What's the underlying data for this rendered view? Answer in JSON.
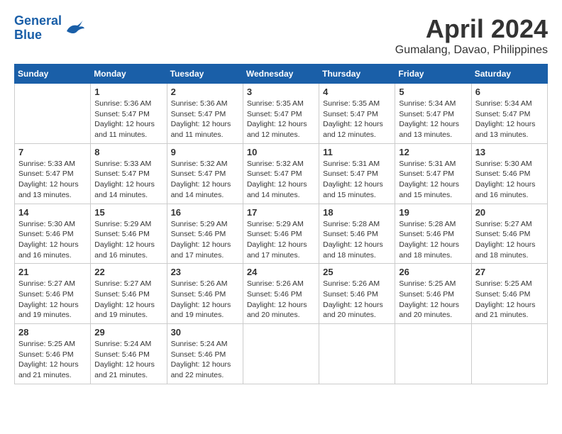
{
  "header": {
    "logo_line1": "General",
    "logo_line2": "Blue",
    "month_title": "April 2024",
    "subtitle": "Gumalang, Davao, Philippines"
  },
  "weekdays": [
    "Sunday",
    "Monday",
    "Tuesday",
    "Wednesday",
    "Thursday",
    "Friday",
    "Saturday"
  ],
  "weeks": [
    [
      {
        "day": "",
        "info": ""
      },
      {
        "day": "1",
        "info": "Sunrise: 5:36 AM\nSunset: 5:47 PM\nDaylight: 12 hours\nand 11 minutes."
      },
      {
        "day": "2",
        "info": "Sunrise: 5:36 AM\nSunset: 5:47 PM\nDaylight: 12 hours\nand 11 minutes."
      },
      {
        "day": "3",
        "info": "Sunrise: 5:35 AM\nSunset: 5:47 PM\nDaylight: 12 hours\nand 12 minutes."
      },
      {
        "day": "4",
        "info": "Sunrise: 5:35 AM\nSunset: 5:47 PM\nDaylight: 12 hours\nand 12 minutes."
      },
      {
        "day": "5",
        "info": "Sunrise: 5:34 AM\nSunset: 5:47 PM\nDaylight: 12 hours\nand 13 minutes."
      },
      {
        "day": "6",
        "info": "Sunrise: 5:34 AM\nSunset: 5:47 PM\nDaylight: 12 hours\nand 13 minutes."
      }
    ],
    [
      {
        "day": "7",
        "info": "Sunrise: 5:33 AM\nSunset: 5:47 PM\nDaylight: 12 hours\nand 13 minutes."
      },
      {
        "day": "8",
        "info": "Sunrise: 5:33 AM\nSunset: 5:47 PM\nDaylight: 12 hours\nand 14 minutes."
      },
      {
        "day": "9",
        "info": "Sunrise: 5:32 AM\nSunset: 5:47 PM\nDaylight: 12 hours\nand 14 minutes."
      },
      {
        "day": "10",
        "info": "Sunrise: 5:32 AM\nSunset: 5:47 PM\nDaylight: 12 hours\nand 14 minutes."
      },
      {
        "day": "11",
        "info": "Sunrise: 5:31 AM\nSunset: 5:47 PM\nDaylight: 12 hours\nand 15 minutes."
      },
      {
        "day": "12",
        "info": "Sunrise: 5:31 AM\nSunset: 5:47 PM\nDaylight: 12 hours\nand 15 minutes."
      },
      {
        "day": "13",
        "info": "Sunrise: 5:30 AM\nSunset: 5:46 PM\nDaylight: 12 hours\nand 16 minutes."
      }
    ],
    [
      {
        "day": "14",
        "info": "Sunrise: 5:30 AM\nSunset: 5:46 PM\nDaylight: 12 hours\nand 16 minutes."
      },
      {
        "day": "15",
        "info": "Sunrise: 5:29 AM\nSunset: 5:46 PM\nDaylight: 12 hours\nand 16 minutes."
      },
      {
        "day": "16",
        "info": "Sunrise: 5:29 AM\nSunset: 5:46 PM\nDaylight: 12 hours\nand 17 minutes."
      },
      {
        "day": "17",
        "info": "Sunrise: 5:29 AM\nSunset: 5:46 PM\nDaylight: 12 hours\nand 17 minutes."
      },
      {
        "day": "18",
        "info": "Sunrise: 5:28 AM\nSunset: 5:46 PM\nDaylight: 12 hours\nand 18 minutes."
      },
      {
        "day": "19",
        "info": "Sunrise: 5:28 AM\nSunset: 5:46 PM\nDaylight: 12 hours\nand 18 minutes."
      },
      {
        "day": "20",
        "info": "Sunrise: 5:27 AM\nSunset: 5:46 PM\nDaylight: 12 hours\nand 18 minutes."
      }
    ],
    [
      {
        "day": "21",
        "info": "Sunrise: 5:27 AM\nSunset: 5:46 PM\nDaylight: 12 hours\nand 19 minutes."
      },
      {
        "day": "22",
        "info": "Sunrise: 5:27 AM\nSunset: 5:46 PM\nDaylight: 12 hours\nand 19 minutes."
      },
      {
        "day": "23",
        "info": "Sunrise: 5:26 AM\nSunset: 5:46 PM\nDaylight: 12 hours\nand 19 minutes."
      },
      {
        "day": "24",
        "info": "Sunrise: 5:26 AM\nSunset: 5:46 PM\nDaylight: 12 hours\nand 20 minutes."
      },
      {
        "day": "25",
        "info": "Sunrise: 5:26 AM\nSunset: 5:46 PM\nDaylight: 12 hours\nand 20 minutes."
      },
      {
        "day": "26",
        "info": "Sunrise: 5:25 AM\nSunset: 5:46 PM\nDaylight: 12 hours\nand 20 minutes."
      },
      {
        "day": "27",
        "info": "Sunrise: 5:25 AM\nSunset: 5:46 PM\nDaylight: 12 hours\nand 21 minutes."
      }
    ],
    [
      {
        "day": "28",
        "info": "Sunrise: 5:25 AM\nSunset: 5:46 PM\nDaylight: 12 hours\nand 21 minutes."
      },
      {
        "day": "29",
        "info": "Sunrise: 5:24 AM\nSunset: 5:46 PM\nDaylight: 12 hours\nand 21 minutes."
      },
      {
        "day": "30",
        "info": "Sunrise: 5:24 AM\nSunset: 5:46 PM\nDaylight: 12 hours\nand 22 minutes."
      },
      {
        "day": "",
        "info": ""
      },
      {
        "day": "",
        "info": ""
      },
      {
        "day": "",
        "info": ""
      },
      {
        "day": "",
        "info": ""
      }
    ]
  ]
}
